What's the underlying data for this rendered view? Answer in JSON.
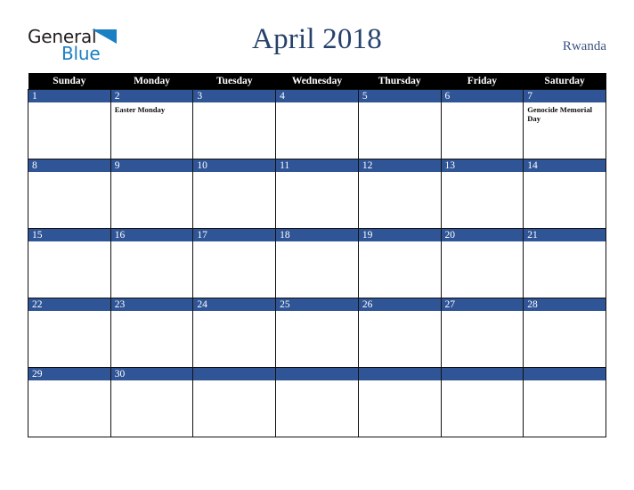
{
  "brand": {
    "name_part1": "General",
    "name_part2": "Blue",
    "triangle_icon": "triangle-icon",
    "color_dark": "#231f20",
    "color_blue": "#1b7fc4"
  },
  "header": {
    "title": "April 2018",
    "country": "Rwanda",
    "title_color": "#26416b"
  },
  "calendar": {
    "month": "April",
    "year": "2018",
    "accent_color": "#2f5597",
    "header_bg": "#000000",
    "weekday_headers": [
      "Sunday",
      "Monday",
      "Tuesday",
      "Wednesday",
      "Thursday",
      "Friday",
      "Saturday"
    ],
    "weeks": [
      [
        {
          "day": "1",
          "events": []
        },
        {
          "day": "2",
          "events": [
            "Easter Monday"
          ]
        },
        {
          "day": "3",
          "events": []
        },
        {
          "day": "4",
          "events": []
        },
        {
          "day": "5",
          "events": []
        },
        {
          "day": "6",
          "events": []
        },
        {
          "day": "7",
          "events": [
            "Genocide Memorial Day"
          ]
        }
      ],
      [
        {
          "day": "8",
          "events": []
        },
        {
          "day": "9",
          "events": []
        },
        {
          "day": "10",
          "events": []
        },
        {
          "day": "11",
          "events": []
        },
        {
          "day": "12",
          "events": []
        },
        {
          "day": "13",
          "events": []
        },
        {
          "day": "14",
          "events": []
        }
      ],
      [
        {
          "day": "15",
          "events": []
        },
        {
          "day": "16",
          "events": []
        },
        {
          "day": "17",
          "events": []
        },
        {
          "day": "18",
          "events": []
        },
        {
          "day": "19",
          "events": []
        },
        {
          "day": "20",
          "events": []
        },
        {
          "day": "21",
          "events": []
        }
      ],
      [
        {
          "day": "22",
          "events": []
        },
        {
          "day": "23",
          "events": []
        },
        {
          "day": "24",
          "events": []
        },
        {
          "day": "25",
          "events": []
        },
        {
          "day": "26",
          "events": []
        },
        {
          "day": "27",
          "events": []
        },
        {
          "day": "28",
          "events": []
        }
      ],
      [
        {
          "day": "29",
          "events": []
        },
        {
          "day": "30",
          "events": []
        },
        {
          "day": "",
          "events": []
        },
        {
          "day": "",
          "events": []
        },
        {
          "day": "",
          "events": []
        },
        {
          "day": "",
          "events": []
        },
        {
          "day": "",
          "events": []
        }
      ]
    ]
  }
}
